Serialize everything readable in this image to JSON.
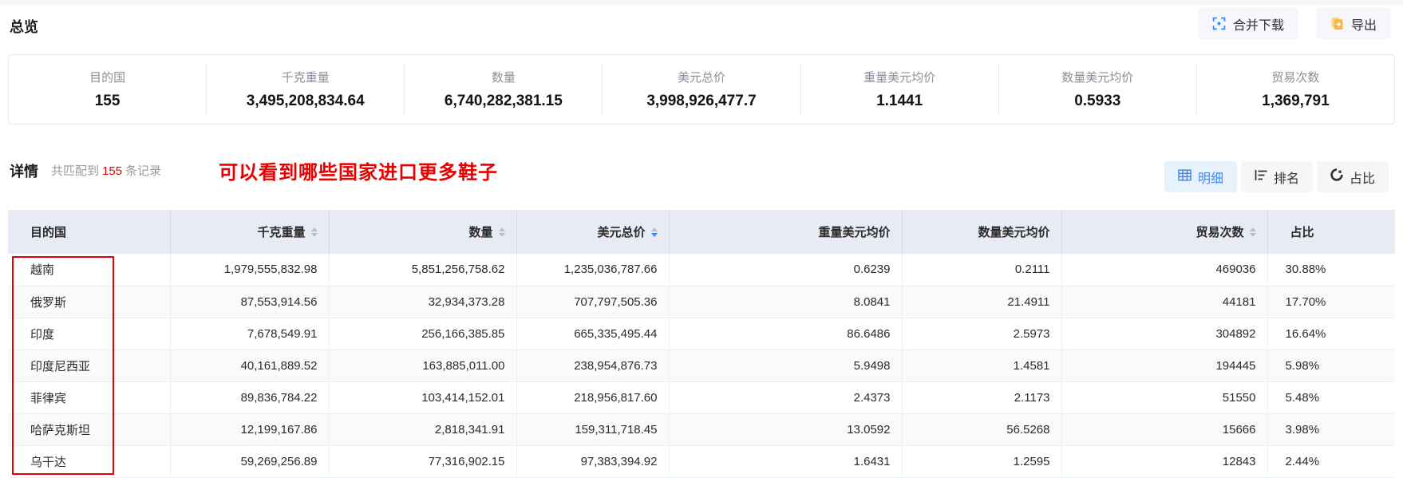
{
  "overview": {
    "title": "总览",
    "merge_download_label": "合并下载",
    "export_label": "导出",
    "stats": [
      {
        "label": "目的国",
        "value": "155"
      },
      {
        "label": "千克重量",
        "value": "3,495,208,834.64"
      },
      {
        "label": "数量",
        "value": "6,740,282,381.15"
      },
      {
        "label": "美元总价",
        "value": "3,998,926,477.7"
      },
      {
        "label": "重量美元均价",
        "value": "1.1441"
      },
      {
        "label": "数量美元均价",
        "value": "0.5933"
      },
      {
        "label": "贸易次数",
        "value": "1,369,791"
      }
    ]
  },
  "details": {
    "title": "详情",
    "match_prefix": "共匹配到",
    "match_count": "155",
    "match_suffix": "条记录",
    "annotation": "可以看到哪些国家进口更多鞋子",
    "view_buttons": {
      "detail": "明细",
      "ranking": "排名",
      "proportion": "占比"
    }
  },
  "table": {
    "columns": [
      {
        "label": "目的国",
        "sortable": false,
        "sort": "none"
      },
      {
        "label": "千克重量",
        "sortable": true,
        "sort": "none"
      },
      {
        "label": "数量",
        "sortable": true,
        "sort": "none"
      },
      {
        "label": "美元总价",
        "sortable": true,
        "sort": "desc"
      },
      {
        "label": "重量美元均价",
        "sortable": false,
        "sort": "none"
      },
      {
        "label": "数量美元均价",
        "sortable": false,
        "sort": "none"
      },
      {
        "label": "贸易次数",
        "sortable": true,
        "sort": "none"
      },
      {
        "label": "占比",
        "sortable": false,
        "sort": "none"
      }
    ],
    "rows": [
      [
        "越南",
        "1,979,555,832.98",
        "5,851,256,758.62",
        "1,235,036,787.66",
        "0.6239",
        "0.2111",
        "469036",
        "30.88%"
      ],
      [
        "俄罗斯",
        "87,553,914.56",
        "32,934,373.28",
        "707,797,505.36",
        "8.0841",
        "21.4911",
        "44181",
        "17.70%"
      ],
      [
        "印度",
        "7,678,549.91",
        "256,166,385.85",
        "665,335,495.44",
        "86.6486",
        "2.5973",
        "304892",
        "16.64%"
      ],
      [
        "印度尼西亚",
        "40,161,889.52",
        "163,885,011.00",
        "238,954,876.73",
        "5.9498",
        "1.4581",
        "194445",
        "5.98%"
      ],
      [
        "菲律宾",
        "89,836,784.22",
        "103,414,152.01",
        "218,956,817.60",
        "2.4373",
        "2.1173",
        "51550",
        "5.48%"
      ],
      [
        "哈萨克斯坦",
        "12,199,167.86",
        "2,818,341.91",
        "159,311,718.45",
        "13.0592",
        "56.5268",
        "15666",
        "3.98%"
      ],
      [
        "乌干达",
        "59,269,256.89",
        "77,316,902.15",
        "97,383,394.92",
        "1.6431",
        "1.2595",
        "12843",
        "2.44%"
      ]
    ]
  },
  "colors": {
    "accent_blue": "#3d8af5",
    "annotation_red": "#e60000",
    "header_bg": "#e9ebf4",
    "export_orange": "#f8b64c",
    "button_bg": "#f5f6f8"
  }
}
